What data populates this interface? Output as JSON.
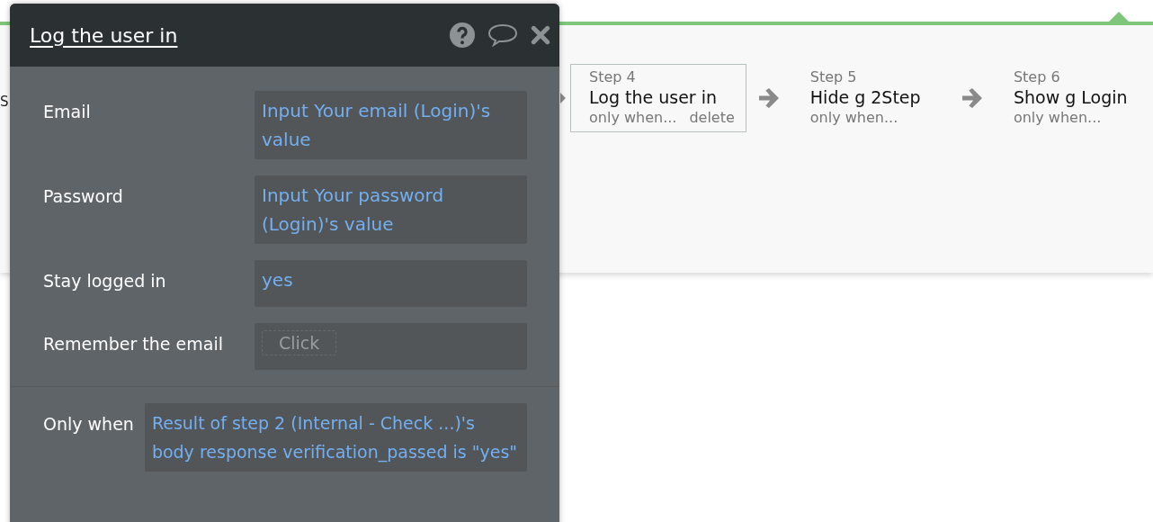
{
  "popup": {
    "title": "Log the user in",
    "fields": [
      {
        "label": "Email",
        "kind": "expression",
        "value": "Input Your email (Login)'s value"
      },
      {
        "label": "Password",
        "kind": "expression",
        "value": "Input Your password (Login)'s value"
      },
      {
        "label": "Stay logged in",
        "kind": "expression",
        "value": "yes"
      },
      {
        "label": "Remember the email",
        "kind": "button",
        "value": "Click"
      }
    ],
    "condition": {
      "label": "Only when",
      "value": "Result of step 2 (Internal - Check ...)'s body response verification_passed is \"yes\""
    }
  },
  "workflow": {
    "partial_step": "S",
    "steps": [
      {
        "step": "Step 4",
        "title": "Log the user in",
        "condition": "only when...",
        "delete": "delete",
        "selected": true
      },
      {
        "step": "Step 5",
        "title": "Hide g 2Step",
        "condition": "only when...",
        "selected": false
      },
      {
        "step": "Step 6",
        "title": "Show g Login",
        "condition": "only when...",
        "selected": false
      }
    ]
  }
}
